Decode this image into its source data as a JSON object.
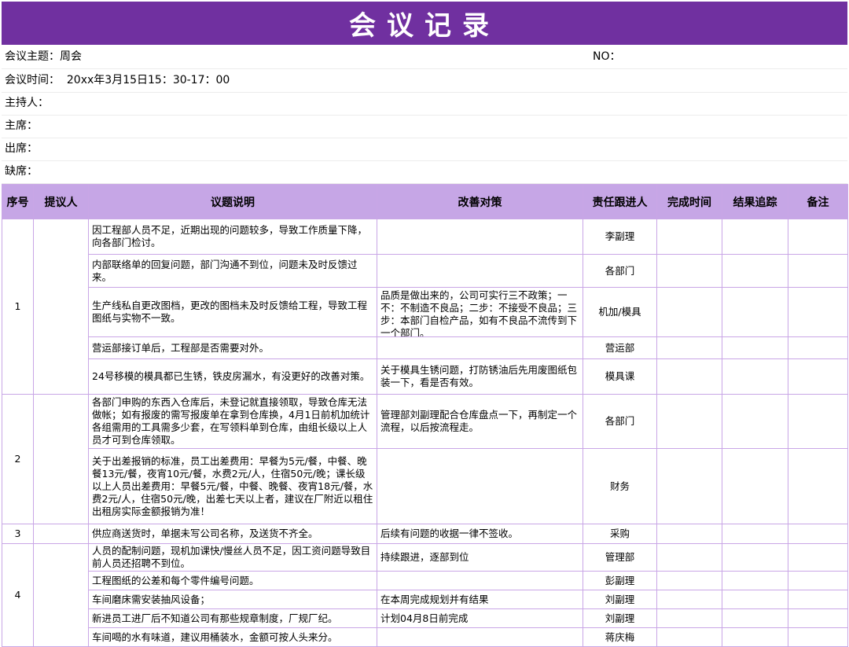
{
  "title": "会议记录",
  "info": {
    "topic": "会议主题：周会",
    "no": "NO：",
    "time": "会议时间：  20xx年3月15日15：30-17：00",
    "host": "主持人：",
    "chair": "主席：",
    "present": "出席：",
    "absent": "缺席："
  },
  "headers": [
    "序号",
    "提议人",
    "议题说明",
    "改善对策",
    "责任跟进人",
    "完成时间",
    "结果追踪",
    "备注"
  ],
  "groups": [
    "1",
    "2",
    "3",
    "4"
  ],
  "rows": [
    {
      "issue": "因工程部人员不足，近期出现的问题较多，导致工作质量下降，向各部门检讨。",
      "measure": "",
      "owner": "李副理"
    },
    {
      "issue": "内部联络单的回复问题，部门沟通不到位，问题未及时反馈过来。",
      "measure": "",
      "owner": "各部门"
    },
    {
      "issue": "生产线私自更改图档，更改的图档未及时反馈给工程，导致工程图纸与实物不一致。",
      "measure": "品质是做出来的，公司可实行三不政策；一不：不制造不良品；二步：不接受不良品；三步：本部门自检产品，如有不良品不流传到下一个部门。",
      "owner": "机加/模具"
    },
    {
      "issue": "营运部接订单后，工程部是否需要对外。",
      "measure": "",
      "owner": "营运部"
    },
    {
      "issue": "24号移模的模具都已生锈，铁皮房漏水，有没更好的改善对策。",
      "measure": "关于模具生锈问题，打防锈油后先用废图纸包装一下，看是否有效。",
      "owner": "模具课"
    },
    {
      "issue": "各部门申购的东西入仓库后，未登记就直接领取，导致仓库无法做帐；如有报废的需写报废单在拿到仓库换，4月1日前机加统计各组需用的工具需多少套，在写领料单到仓库，由组长级以上人员才可到仓库领取。",
      "measure": "管理部刘副理配合仓库盘点一下，再制定一个流程，以后按流程走。",
      "owner": "各部门"
    },
    {
      "issue": "关于出差报销的标准，员工出差费用：早餐为5元/餐，中餐、晚餐13元/餐，夜宵10元/餐，水费2元/人，住宿50元/晚；课长级以上人员出差费用：早餐5元/餐，中餐、晚餐、夜宵18元/餐，水费2元/人，住宿50元/晚，出差七天以上者，建议在厂附近以租住出租房实际金额报销为准！",
      "measure": "",
      "owner": "财务"
    },
    {
      "issue": "供应商送货时，单据未写公司名称，及送货不齐全。",
      "measure": "后续有问题的收据一律不签收。",
      "owner": "采购"
    },
    {
      "issue": "人员的配制问题，现机加课快/慢丝人员不足，因工资问题导致目前人员还招聘不到位。",
      "measure": "持续跟进，逐部到位",
      "owner": "管理部"
    },
    {
      "issue": "工程图纸的公差和每个零件编号问题。",
      "measure": "",
      "owner": "彭副理"
    },
    {
      "issue": "车间磨床需安装抽风设备；",
      "measure": "在本周完成规划并有结果",
      "owner": "刘副理"
    },
    {
      "issue": "新进员工进厂后不知道公司有那些规章制度，厂规厂纪。",
      "measure": "计划04月8日前完成",
      "owner": "刘副理"
    },
    {
      "issue": "车间喝的水有味道，建议用桶装水，金额可按人头来分。",
      "measure": "",
      "owner": "蒋庆梅"
    }
  ]
}
